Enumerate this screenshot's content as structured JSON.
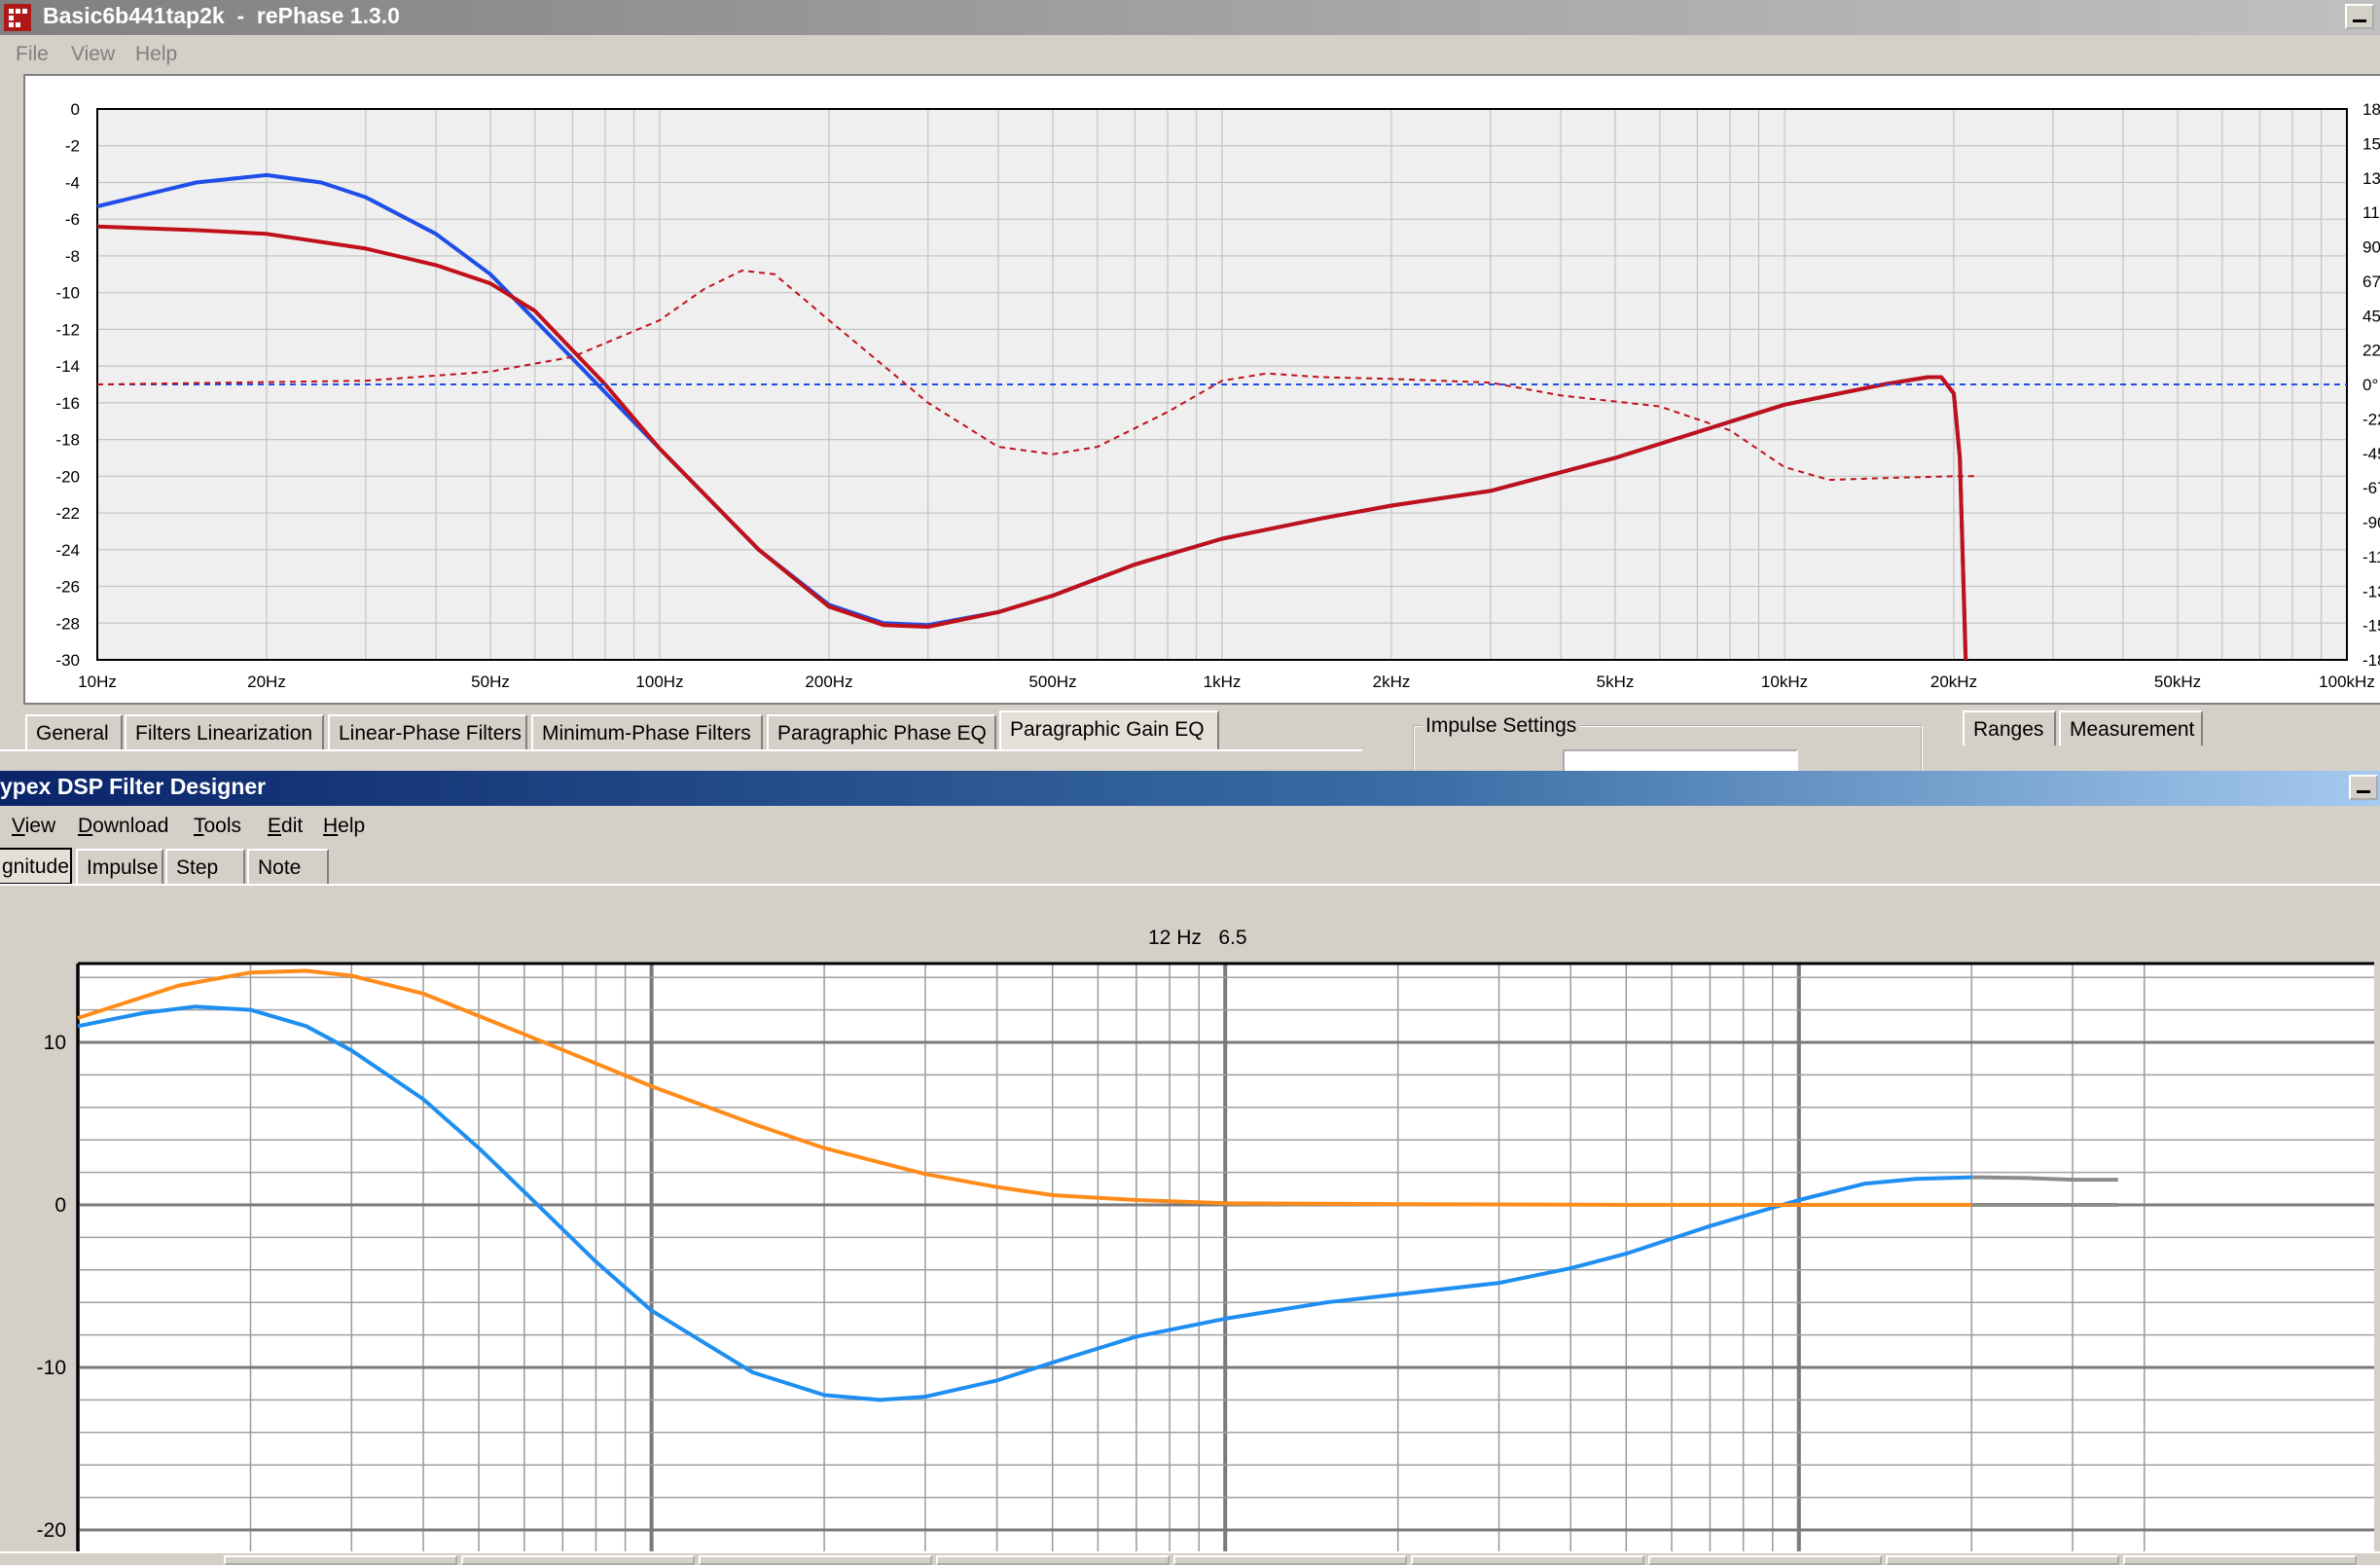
{
  "rephase": {
    "title": "Basic6b441tap2k  -  rePhase 1.3.0",
    "menu": [
      "File",
      "View",
      "Help"
    ],
    "tabs": [
      "General",
      "Filters Linearization",
      "Linear-Phase Filters",
      "Minimum-Phase Filters",
      "Paragraphic Phase EQ",
      "Paragraphic Gain EQ"
    ],
    "active_tab": "Paragraphic Gain EQ",
    "impulse_settings_label": "Impulse Settings",
    "side_tabs": [
      "Ranges",
      "Measurement"
    ]
  },
  "rephase_chart": {
    "type": "line",
    "x_scale": "log",
    "xlim": [
      10,
      100000
    ],
    "ylim": [
      -30,
      0
    ],
    "y_ticks": [
      "0",
      "-2",
      "-4",
      "-6",
      "-8",
      "-10",
      "-12",
      "-14",
      "-16",
      "-18",
      "-20",
      "-22",
      "-24",
      "-26",
      "-28",
      "-30"
    ],
    "x_tick_labels": [
      {
        "f": 10,
        "label": "10Hz"
      },
      {
        "f": 20,
        "label": "20Hz"
      },
      {
        "f": 50,
        "label": "50Hz"
      },
      {
        "f": 100,
        "label": "100Hz"
      },
      {
        "f": 200,
        "label": "200Hz"
      },
      {
        "f": 500,
        "label": "500Hz"
      },
      {
        "f": 1000,
        "label": "1kHz"
      },
      {
        "f": 2000,
        "label": "2kHz"
      },
      {
        "f": 5000,
        "label": "5kHz"
      },
      {
        "f": 10000,
        "label": "10kHz"
      },
      {
        "f": 20000,
        "label": "20kHz"
      },
      {
        "f": 50000,
        "label": "50kHz"
      },
      {
        "f": 100000,
        "label": "100kHz"
      }
    ],
    "right_ticks": [
      "18",
      "15",
      "13",
      "11",
      "90",
      "67",
      "45",
      "22",
      "0°",
      "-22",
      "-45",
      "-67",
      "-90",
      "-11",
      "-13",
      "-15",
      "-18"
    ],
    "colors": {
      "blue": "#1f4ee8",
      "red": "#c0101a"
    },
    "series": [
      {
        "color": "blue",
        "style": "solid",
        "points": [
          [
            10,
            -5.3
          ],
          [
            15,
            -4
          ],
          [
            20,
            -3.6
          ],
          [
            25,
            -4
          ],
          [
            30,
            -4.8
          ],
          [
            40,
            -6.8
          ],
          [
            50,
            -9
          ],
          [
            70,
            -13.6
          ],
          [
            100,
            -18.5
          ],
          [
            150,
            -24
          ],
          [
            200,
            -27
          ],
          [
            250,
            -28
          ],
          [
            300,
            -28.1
          ],
          [
            400,
            -27.4
          ],
          [
            500,
            -26.5
          ],
          [
            700,
            -24.8
          ],
          [
            1000,
            -23.4
          ],
          [
            1500,
            -22.3
          ],
          [
            2000,
            -21.6
          ],
          [
            3000,
            -20.8
          ],
          [
            5000,
            -19
          ],
          [
            10000,
            -16.1
          ],
          [
            15000,
            -15
          ],
          [
            18000,
            -14.6
          ],
          [
            19000,
            -14.6
          ],
          [
            20000,
            -15.5
          ],
          [
            20500,
            -19
          ],
          [
            21000,
            -30
          ]
        ]
      },
      {
        "color": "red",
        "style": "solid",
        "points": [
          [
            10,
            -6.4
          ],
          [
            15,
            -6.6
          ],
          [
            20,
            -6.8
          ],
          [
            30,
            -7.6
          ],
          [
            40,
            -8.5
          ],
          [
            50,
            -9.5
          ],
          [
            60,
            -11
          ],
          [
            80,
            -15
          ],
          [
            100,
            -18.5
          ],
          [
            150,
            -24
          ],
          [
            200,
            -27.1
          ],
          [
            250,
            -28.1
          ],
          [
            300,
            -28.2
          ],
          [
            400,
            -27.4
          ],
          [
            500,
            -26.5
          ],
          [
            700,
            -24.8
          ],
          [
            1000,
            -23.4
          ],
          [
            1500,
            -22.3
          ],
          [
            2000,
            -21.6
          ],
          [
            3000,
            -20.8
          ],
          [
            5000,
            -19
          ],
          [
            10000,
            -16.1
          ],
          [
            15000,
            -15
          ],
          [
            18000,
            -14.6
          ],
          [
            19000,
            -14.6
          ],
          [
            20000,
            -15.5
          ],
          [
            20500,
            -19
          ],
          [
            21000,
            -30
          ]
        ]
      },
      {
        "color": "blue",
        "style": "dashed",
        "points": [
          [
            10,
            -15
          ],
          [
            100000,
            -15
          ]
        ]
      },
      {
        "color": "red",
        "style": "dashed",
        "points": [
          [
            10,
            -15
          ],
          [
            30,
            -14.8
          ],
          [
            50,
            -14.3
          ],
          [
            70,
            -13.5
          ],
          [
            100,
            -11.5
          ],
          [
            120,
            -9.8
          ],
          [
            140,
            -8.8
          ],
          [
            160,
            -9
          ],
          [
            200,
            -11.5
          ],
          [
            300,
            -16
          ],
          [
            400,
            -18.4
          ],
          [
            500,
            -18.8
          ],
          [
            600,
            -18.4
          ],
          [
            800,
            -16.5
          ],
          [
            1000,
            -14.8
          ],
          [
            1200,
            -14.4
          ],
          [
            1500,
            -14.6
          ],
          [
            2000,
            -14.7
          ],
          [
            3000,
            -14.9
          ],
          [
            4000,
            -15.6
          ],
          [
            6000,
            -16.2
          ],
          [
            8000,
            -17.5
          ],
          [
            10000,
            -19.5
          ],
          [
            12000,
            -20.2
          ],
          [
            15000,
            -20.1
          ],
          [
            20000,
            -20
          ],
          [
            22000,
            -20
          ]
        ]
      }
    ]
  },
  "hypex": {
    "title": "ypex DSP Filter Designer",
    "menu": [
      "View",
      "Download",
      "Tools",
      "Edit",
      "Help"
    ],
    "tabs": [
      "gnitude",
      "Impulse",
      "Step",
      "Note"
    ],
    "readout": "12 Hz   6.5"
  },
  "hypex_chart": {
    "type": "line",
    "x_scale": "log",
    "xlim": [
      10,
      40000
    ],
    "ylim": [
      -21,
      15
    ],
    "y_ticks": [
      "10",
      "0",
      "-10",
      "-20"
    ],
    "colors": {
      "blue": "#1e8ef0",
      "orange": "#ff8c1a",
      "gray": "#8c8c8c"
    },
    "series": [
      {
        "color": "blue",
        "points": [
          [
            10,
            11
          ],
          [
            13,
            11.8
          ],
          [
            16,
            12.2
          ],
          [
            20,
            12
          ],
          [
            25,
            11
          ],
          [
            30,
            9.5
          ],
          [
            40,
            6.5
          ],
          [
            50,
            3.5
          ],
          [
            60,
            0.8
          ],
          [
            80,
            -3.5
          ],
          [
            100,
            -6.5
          ],
          [
            150,
            -10.3
          ],
          [
            200,
            -11.7
          ],
          [
            250,
            -12
          ],
          [
            300,
            -11.8
          ],
          [
            400,
            -10.8
          ],
          [
            500,
            -9.7
          ],
          [
            700,
            -8.1
          ],
          [
            1000,
            -7
          ],
          [
            1500,
            -6
          ],
          [
            2000,
            -5.5
          ],
          [
            3000,
            -4.8
          ],
          [
            4000,
            -3.9
          ],
          [
            5000,
            -3
          ],
          [
            7000,
            -1.3
          ],
          [
            10000,
            0.3
          ],
          [
            13000,
            1.3
          ],
          [
            16000,
            1.6
          ],
          [
            20000,
            1.7
          ]
        ]
      },
      {
        "color": "orange",
        "points": [
          [
            10,
            11.5
          ],
          [
            15,
            13.5
          ],
          [
            20,
            14.3
          ],
          [
            25,
            14.4
          ],
          [
            30,
            14.1
          ],
          [
            40,
            13
          ],
          [
            60,
            10.5
          ],
          [
            80,
            8.7
          ],
          [
            100,
            7.3
          ],
          [
            150,
            5
          ],
          [
            200,
            3.5
          ],
          [
            300,
            1.9
          ],
          [
            400,
            1.1
          ],
          [
            500,
            0.6
          ],
          [
            700,
            0.3
          ],
          [
            1000,
            0.1
          ],
          [
            2000,
            0.05
          ],
          [
            5000,
            0
          ],
          [
            10000,
            0
          ],
          [
            20000,
            0
          ]
        ]
      },
      {
        "color": "gray",
        "points": [
          [
            20000,
            1.7
          ],
          [
            25000,
            1.65
          ],
          [
            30000,
            1.55
          ],
          [
            36000,
            1.55
          ]
        ]
      },
      {
        "color": "gray",
        "points": [
          [
            20000,
            0
          ],
          [
            36000,
            0
          ]
        ]
      }
    ]
  }
}
